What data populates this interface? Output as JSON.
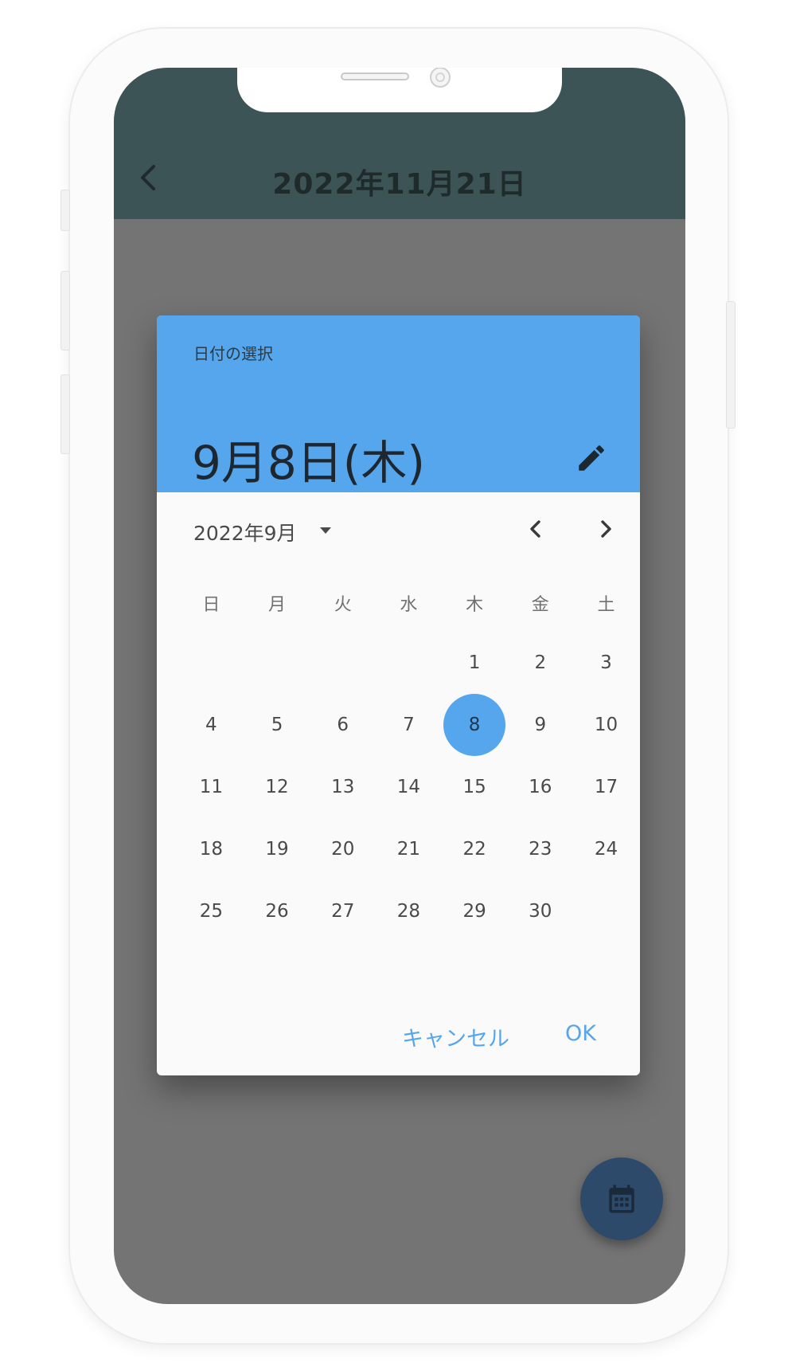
{
  "appbar": {
    "title": "2022年11月21日",
    "back_icon": "chevron-left-icon"
  },
  "dialog": {
    "help_text": "日付の選択",
    "selected_date": "9月8日(木)",
    "edit_icon": "pencil-icon",
    "month_label": "2022年9月",
    "dropdown_icon": "caret-down-icon",
    "prev_icon": "chevron-left-icon",
    "next_icon": "chevron-right-icon",
    "weekdays": [
      "日",
      "月",
      "火",
      "水",
      "木",
      "金",
      "土"
    ],
    "weeks": [
      [
        "",
        "",
        "",
        "",
        "1",
        "2",
        "3"
      ],
      [
        "4",
        "5",
        "6",
        "7",
        "8",
        "9",
        "10"
      ],
      [
        "11",
        "12",
        "13",
        "14",
        "15",
        "16",
        "17"
      ],
      [
        "18",
        "19",
        "20",
        "21",
        "22",
        "23",
        "24"
      ],
      [
        "25",
        "26",
        "27",
        "28",
        "29",
        "30",
        ""
      ]
    ],
    "selected_day": "8",
    "cancel_label": "キャンセル",
    "ok_label": "OK"
  },
  "fab": {
    "icon": "calendar-icon"
  },
  "colors": {
    "accent": "#55a6ec",
    "appbar": "#3d5457",
    "scrim": "#747474",
    "fab": "#2d4a6b"
  }
}
